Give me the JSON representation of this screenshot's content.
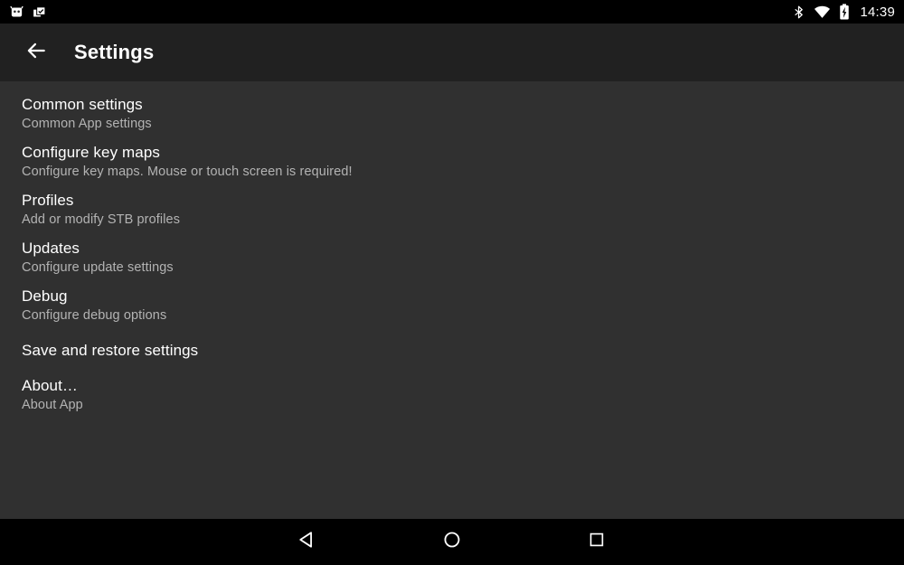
{
  "status_bar": {
    "notification_icons": [
      {
        "name": "app-notification-icon",
        "label": "App notification"
      },
      {
        "name": "clipboard-check-notification-icon",
        "label": "Clipboard notification"
      }
    ],
    "system_icons": [
      {
        "name": "bluetooth-icon",
        "label": "Bluetooth"
      },
      {
        "name": "wifi-icon",
        "label": "Wi-Fi"
      },
      {
        "name": "battery-charging-icon",
        "label": "Battery charging"
      }
    ],
    "clock": "14:39"
  },
  "toolbar": {
    "back_label": "Back",
    "title": "Settings"
  },
  "settings": {
    "items": [
      {
        "title": "Common settings",
        "summary": "Common App settings",
        "name": "common-settings"
      },
      {
        "title": "Configure key maps",
        "summary": "Configure key maps. Mouse or touch screen is required!",
        "name": "configure-key-maps"
      },
      {
        "title": "Profiles",
        "summary": "Add or modify STB profiles",
        "name": "profiles"
      },
      {
        "title": "Updates",
        "summary": "Configure update settings",
        "name": "updates"
      },
      {
        "title": "Debug",
        "summary": "Configure debug options",
        "name": "debug"
      },
      {
        "title": "Save and restore settings",
        "summary": "",
        "name": "save-and-restore-settings"
      },
      {
        "title": "About…",
        "summary": "About App",
        "name": "about"
      }
    ]
  },
  "nav_bar": {
    "back_label": "Back",
    "home_label": "Home",
    "recents_label": "Recent apps"
  },
  "colors": {
    "status_bar_bg": "#000000",
    "toolbar_bg": "#212121",
    "content_bg": "#303030",
    "nav_bar_bg": "#000000",
    "title_text": "#ffffff",
    "summary_text": "#b3b3b3"
  }
}
